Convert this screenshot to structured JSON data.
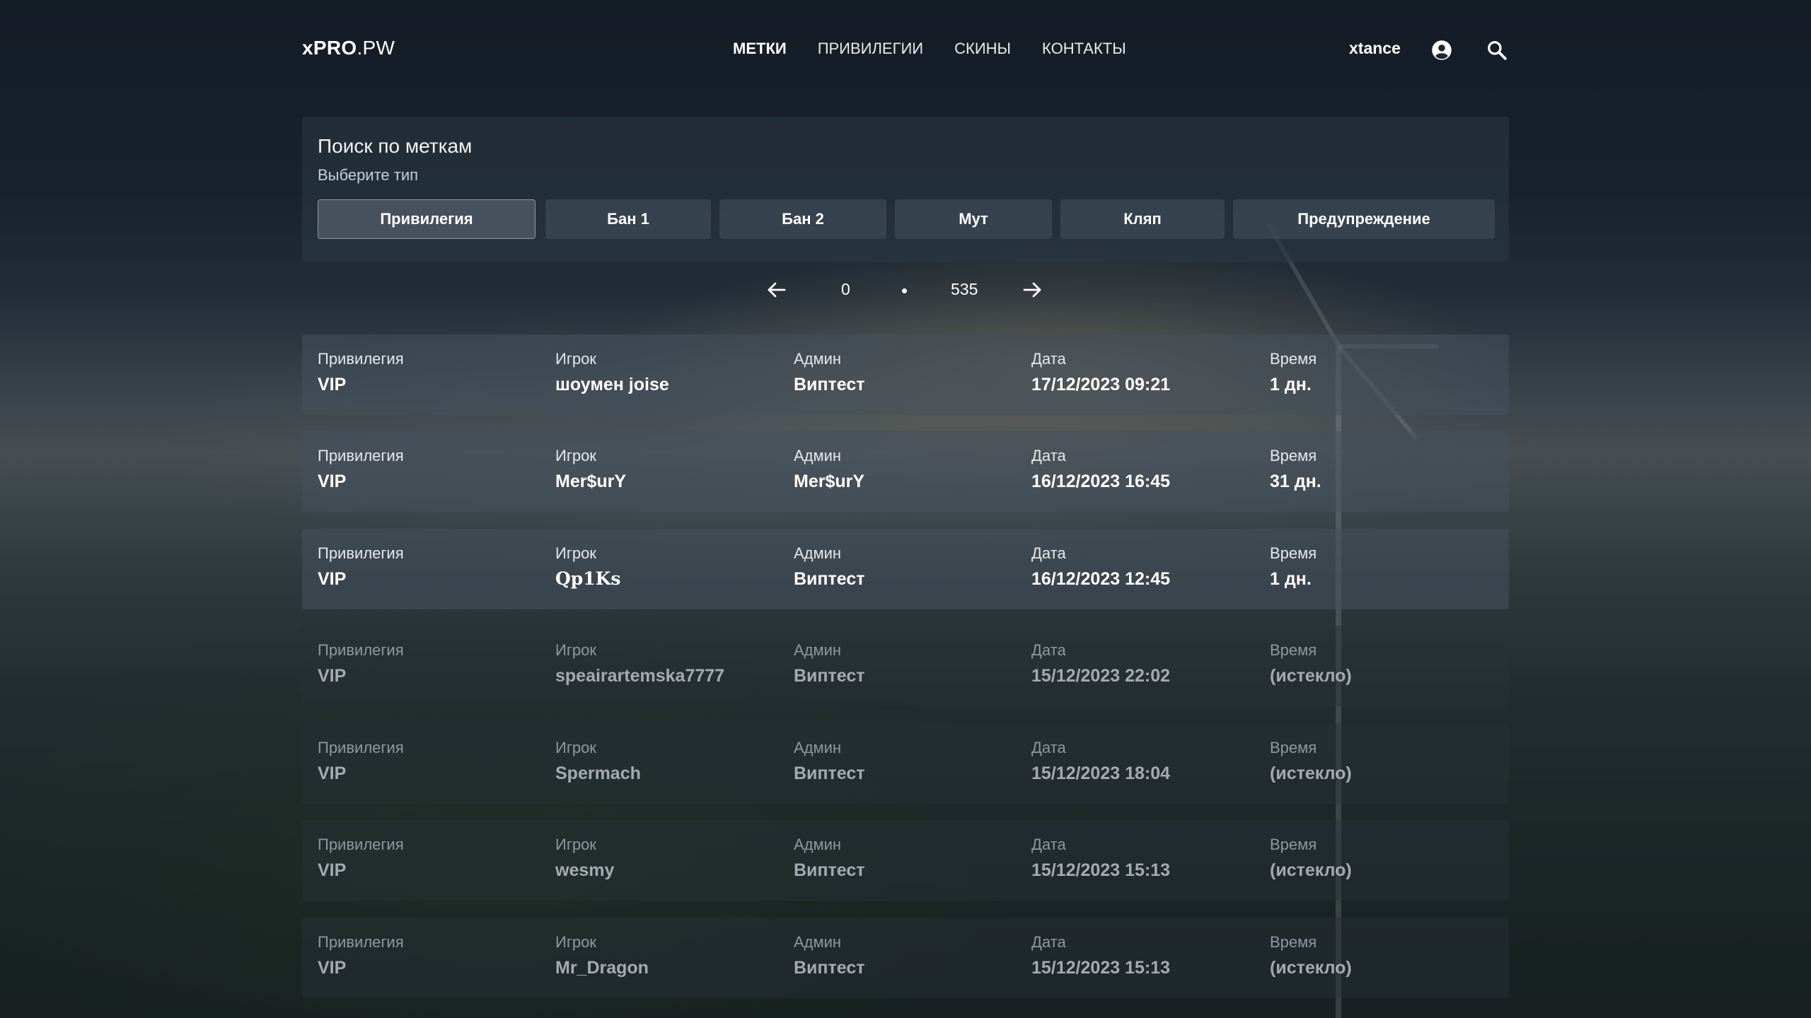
{
  "header": {
    "logo_bold": "xPRO",
    "logo_rest": ".PW",
    "nav": [
      {
        "label": "МЕТКИ",
        "active": true
      },
      {
        "label": "ПРИВИЛЕГИИ",
        "active": false
      },
      {
        "label": "СКИНЫ",
        "active": false
      },
      {
        "label": "КОНТАКТЫ",
        "active": false
      }
    ],
    "username": "xtance",
    "icons": {
      "account": "account-circle-icon",
      "search": "search-icon"
    }
  },
  "search": {
    "title": "Поиск по меткам",
    "subtitle": "Выберите тип",
    "types": [
      {
        "label": "Привилегия",
        "active": true
      },
      {
        "label": "Бан 1",
        "active": false
      },
      {
        "label": "Бан 2",
        "active": false
      },
      {
        "label": "Мут",
        "active": false
      },
      {
        "label": "Кляп",
        "active": false
      },
      {
        "label": "Предупреждение",
        "active": false
      }
    ]
  },
  "pagination": {
    "current": "0",
    "total": "535"
  },
  "columns": {
    "type": "Привилегия",
    "player": "Игрок",
    "admin": "Админ",
    "date": "Дата",
    "time": "Время"
  },
  "records": [
    {
      "type": "VIP",
      "player": "шоумен joise",
      "admin": "Виптест",
      "date": "17/12/2023 09:21",
      "time": "1 дн.",
      "expired": false
    },
    {
      "type": "VIP",
      "player": "Mer$urY",
      "admin": "Mer$urY",
      "date": "16/12/2023 16:45",
      "time": "31 дн.",
      "expired": false
    },
    {
      "type": "VIP",
      "player": "Qp1Ks",
      "admin": "Виптест",
      "date": "16/12/2023 12:45",
      "time": "1 дн.",
      "expired": false
    },
    {
      "type": "VIP",
      "player": "speairartemska7777",
      "admin": "Виптест",
      "date": "15/12/2023 22:02",
      "time": "(истекло)",
      "expired": true
    },
    {
      "type": "VIP",
      "player": "Spermach",
      "admin": "Виптест",
      "date": "15/12/2023 18:04",
      "time": "(истекло)",
      "expired": true
    },
    {
      "type": "VIP",
      "player": "wesmy",
      "admin": "Виптест",
      "date": "15/12/2023 15:13",
      "time": "(истекло)",
      "expired": true
    },
    {
      "type": "VIP",
      "player": "Mr_Dragon",
      "admin": "Виптест",
      "date": "15/12/2023 15:13",
      "time": "(истекло)",
      "expired": true
    }
  ]
}
